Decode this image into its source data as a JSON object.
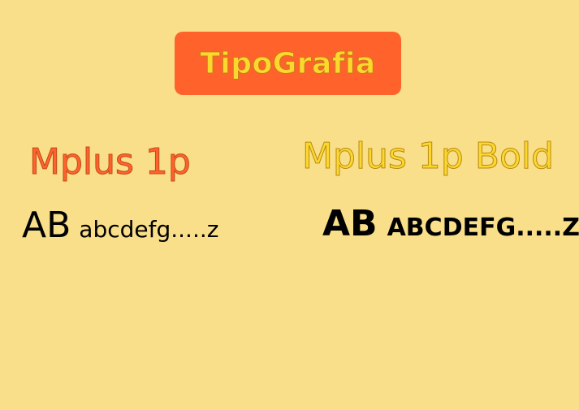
{
  "title": "TipoGrafia",
  "columns": [
    {
      "heading": "Mplus 1p",
      "sample_big": "AB",
      "sample_small": "abcdefg.....z"
    },
    {
      "heading": "Mplus 1p Bold",
      "sample_big": "AB",
      "sample_small": "ABCDEFG.....Z"
    }
  ],
  "colors": {
    "background": "#f9df89",
    "badge": "#ff632b",
    "title_text": "#fcd82e",
    "heading_left": "#ff632b",
    "heading_right": "#fcd82e"
  }
}
